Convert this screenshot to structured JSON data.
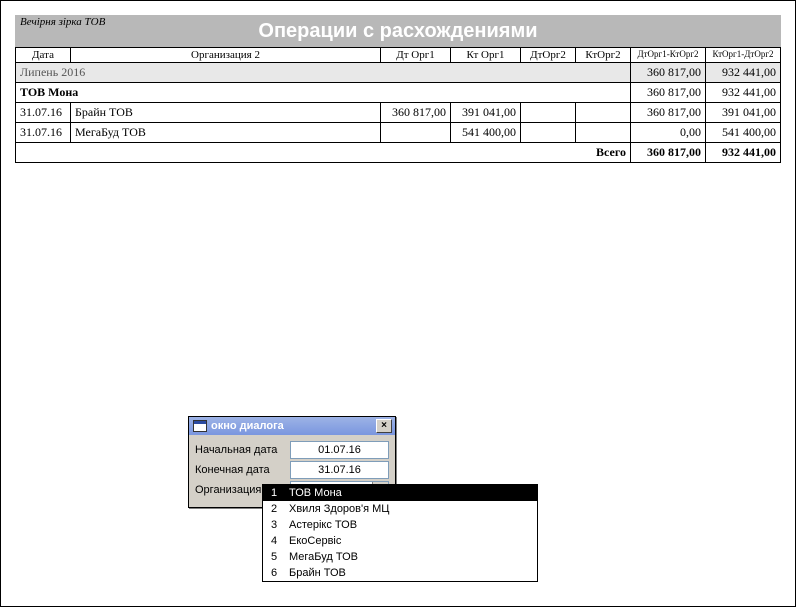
{
  "header": {
    "org": "Вечірня зірка ТОВ",
    "title": "Операции с расхождениями"
  },
  "columns": {
    "c0": "Дата",
    "c1": "Организация 2",
    "c2": "Дт Орг1",
    "c3": "Кт Орг1",
    "c4": "ДтОрг2",
    "c5": "КтОрг2",
    "c6": "ДтОрг1-КтОрг2",
    "c7": "КтОрг1-ДтОрг2"
  },
  "month": {
    "label": "Липень 2016",
    "v6": "360 817,00",
    "v7": "932 441,00"
  },
  "orgrow": {
    "label": "ТОВ Мона",
    "v6": "360 817,00",
    "v7": "932 441,00"
  },
  "rows": [
    {
      "date": "31.07.16",
      "org": "Брайн ТОВ",
      "dt1": "360 817,00",
      "kt1": "391 041,00",
      "dt2": "",
      "kt2": "",
      "d6": "360 817,00",
      "d7": "391 041,00"
    },
    {
      "date": "31.07.16",
      "org": "МегаБуд ТОВ",
      "dt1": "",
      "kt1": "541 400,00",
      "dt2": "",
      "kt2": "",
      "d6": "0,00",
      "d7": "541 400,00"
    }
  ],
  "totals": {
    "label": "Всего",
    "v6": "360 817,00",
    "v7": "932 441,00"
  },
  "dialog": {
    "title": "окно диалога",
    "start_label": "Начальная дата",
    "start_val": "01.07.16",
    "end_label": "Конечная дата",
    "end_val": "31.07.16",
    "org_label": "Организация",
    "org_val": "1"
  },
  "dropdown": [
    {
      "idx": "1",
      "text": "ТОВ Мона"
    },
    {
      "idx": "2",
      "text": "Хвиля Здоров'я МЦ"
    },
    {
      "idx": "3",
      "text": "Астерікс ТОВ"
    },
    {
      "idx": "4",
      "text": "ЕкоСервіс"
    },
    {
      "idx": "5",
      "text": "МегаБуд ТОВ"
    },
    {
      "idx": "6",
      "text": "Брайн ТОВ"
    }
  ]
}
